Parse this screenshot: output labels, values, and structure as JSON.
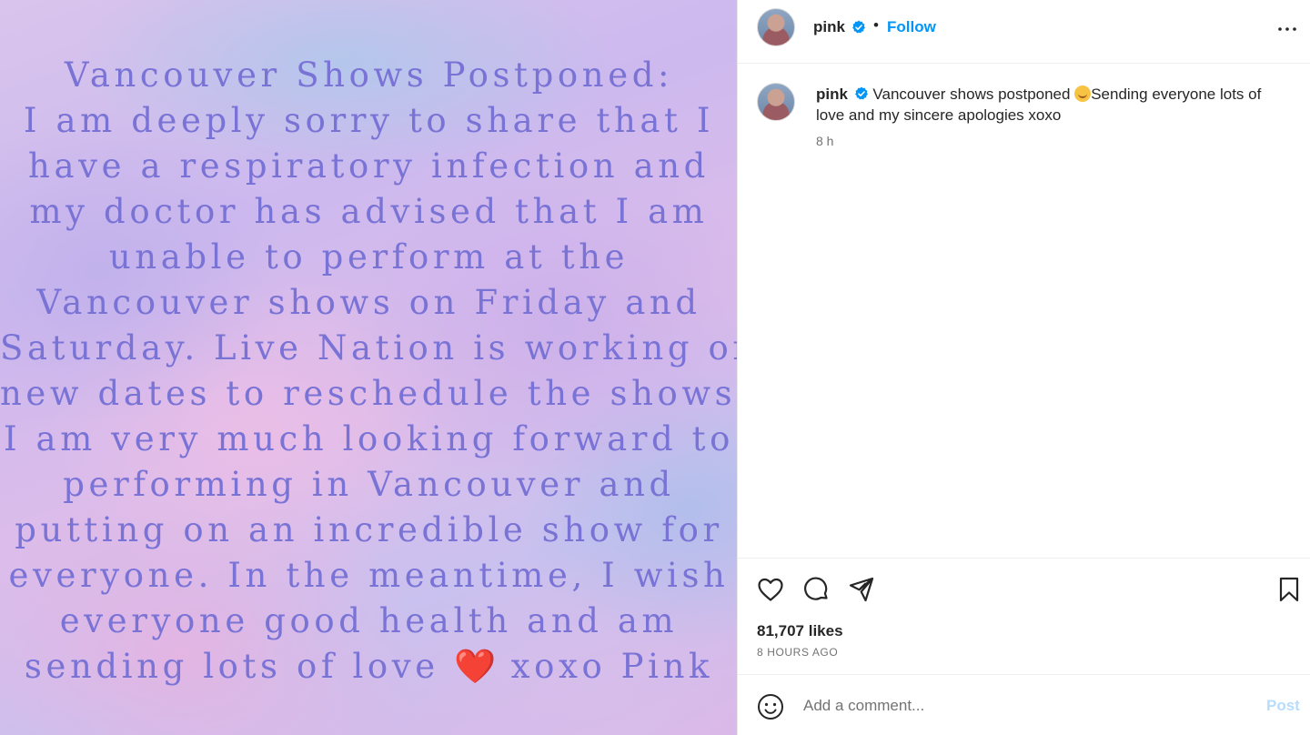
{
  "media": {
    "lines": [
      "Vancouver Shows Postponed:",
      "I am deeply sorry to share that I",
      "have a respiratory infection and",
      "my doctor has advised that I am",
      "unable to perform at the",
      "Vancouver shows on Friday and",
      "Saturday. Live Nation is working on",
      "new dates to reschedule the shows.",
      "I am very much looking forward to",
      "performing in Vancouver and",
      "putting on an incredible show for",
      "everyone. In the meantime, I wish",
      "everyone good health and am"
    ],
    "last_line_before": "sending lots of love",
    "last_line_heart": "❤️",
    "last_line_after": "xoxo Pink"
  },
  "header": {
    "username": "pink",
    "separator": "•",
    "follow_label": "Follow"
  },
  "caption": {
    "username": "pink",
    "text_before": "Vancouver shows postponed ",
    "text_after": "Sending everyone lots of love and my sincere apologies xoxo",
    "time": "8 h"
  },
  "engagement": {
    "likes": "81,707 likes",
    "posted_ago": "8 HOURS AGO"
  },
  "comment_box": {
    "placeholder": "Add a comment...",
    "post_label": "Post"
  },
  "colors": {
    "link_blue": "#0095f6",
    "post_disabled": "#b9dcfb",
    "notice_text": "#7a73d6"
  },
  "icons": [
    "more-options-icon",
    "verified-badge-icon",
    "heart-icon",
    "comment-icon",
    "share-icon",
    "save-bookmark-icon",
    "emoji-icon"
  ]
}
